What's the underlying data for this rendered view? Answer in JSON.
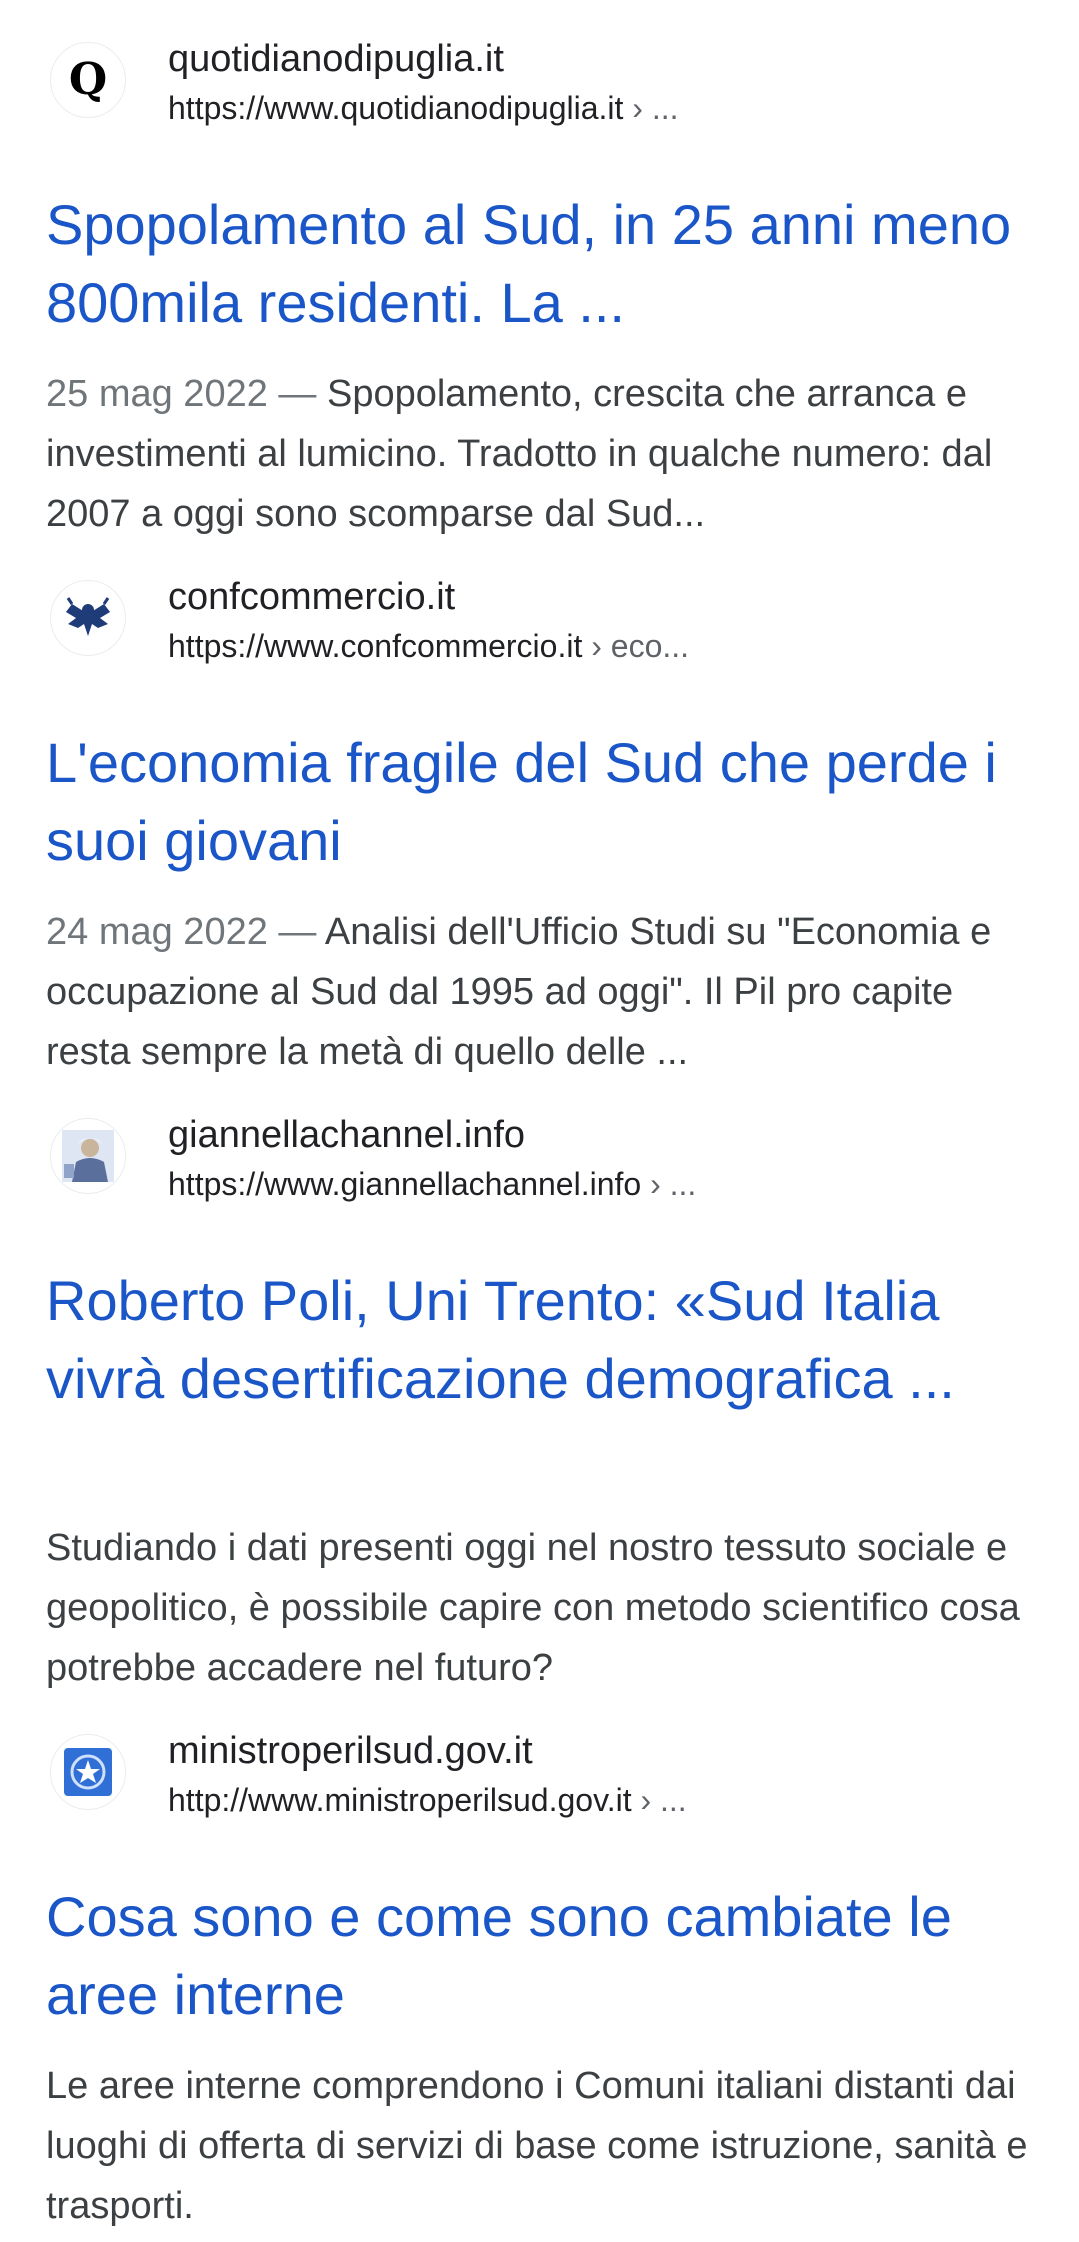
{
  "results": [
    {
      "favicon": "q-logo-icon",
      "site_name": "quotidianodipuglia.it",
      "url": "https://www.quotidianodipuglia.it",
      "crumb": " › ...",
      "title": "Spopolamento al Sud, in 25 anni meno 800mila residenti. La ...",
      "date": "25 mag 2022",
      "separator": " — ",
      "snippet": "Spopolamento, crescita che arranca e investimenti al lumicino. Tradotto in qualche numero: dal 2007 a oggi sono scomparse dal Sud..."
    },
    {
      "favicon": "eagle-emblem-icon",
      "site_name": "confcommercio.it",
      "url": "https://www.confcommercio.it",
      "crumb": " › eco...",
      "title": "L'economia fragile del Sud che perde i suoi giovani",
      "date": "24 mag 2022",
      "separator": " — ",
      "snippet": "Analisi dell'Ufficio Studi su \"Economia e occupazione al Sud dal 1995 ad oggi\". Il Pil pro capite resta sempre la metà di quello delle ..."
    },
    {
      "favicon": "portrait-thumbnail-icon",
      "site_name": "giannellachannel.info",
      "url": "https://www.giannellachannel.info",
      "crumb": " › ...",
      "title": "Roberto Poli, Uni Trento: «Sud Italia vivrà desertificazione demografica ...",
      "date": "",
      "separator": "",
      "snippet": "Studiando i dati presenti oggi nel nostro tessuto sociale e geopolitico, è possibile capire con metodo scientifico cosa potrebbe accadere nel futuro?"
    },
    {
      "favicon": "italian-emblem-icon",
      "site_name": "ministroperilsud.gov.it",
      "url": "http://www.ministroperilsud.gov.it",
      "crumb": " › ...",
      "title": "Cosa sono e come sono cambiate le aree interne",
      "date": "",
      "separator": "",
      "snippet": "Le aree interne comprendono i Comuni italiani distanti dai luoghi di offerta di servizi di base come istruzione, sanità e trasporti."
    }
  ],
  "colors": {
    "title_link": "#1a56c8",
    "snippet_text": "#3c4043",
    "date_text": "#70757a",
    "site_text": "#202124"
  }
}
